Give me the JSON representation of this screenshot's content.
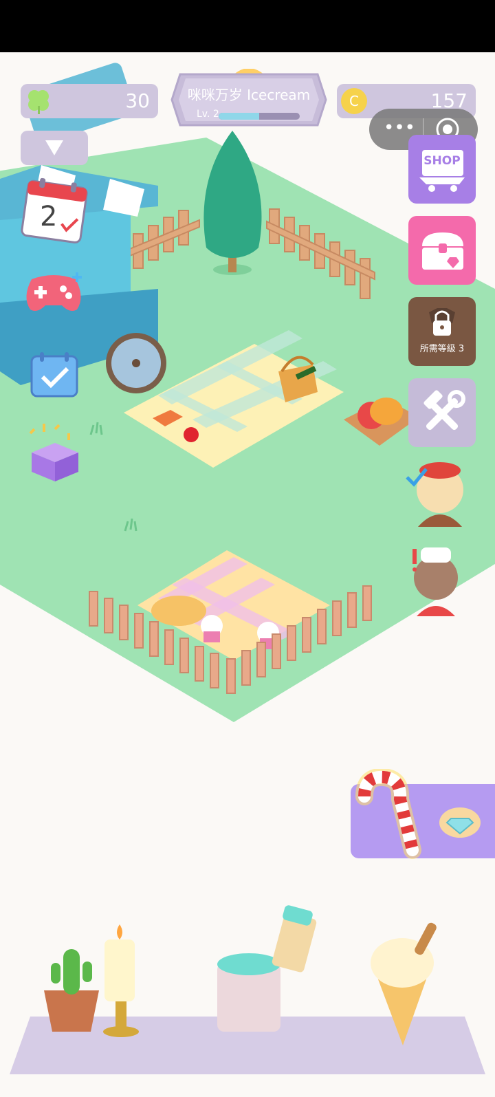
{
  "hud": {
    "clover_count": "30",
    "coin_count": "157",
    "coin_symbol": "C",
    "shop_title": "咪咪万岁 Icecream",
    "level_label": "Lv. 2",
    "level_progress": 0.5
  },
  "side_menu": {
    "shop_label": "SHOP",
    "locked_label": "所需等級 3"
  },
  "calendar": {
    "day": "2"
  },
  "icons": {
    "clover": "clover-icon",
    "coin": "coin-icon",
    "more": "more-icon",
    "target": "target-icon",
    "dropdown": "dropdown-arrow-icon",
    "calendar": "calendar-checkin-icon",
    "gamepad": "gamepad-icon",
    "checklist": "task-check-icon",
    "gift": "gift-box-icon",
    "shop": "shop-cart-icon",
    "chest": "treasure-chest-icon",
    "lock": "lock-icon",
    "tools": "hammer-wrench-icon",
    "diamond": "diamond-icon",
    "candy_cane": "candy-cane-icon"
  },
  "colors": {
    "panel": "#cfc6de",
    "grass": "#9fe3b3",
    "shop_button": "#a77fe6",
    "chest_button": "#f46aab",
    "locked_button": "#7a5742",
    "candy_panel": "#b59bf1"
  }
}
